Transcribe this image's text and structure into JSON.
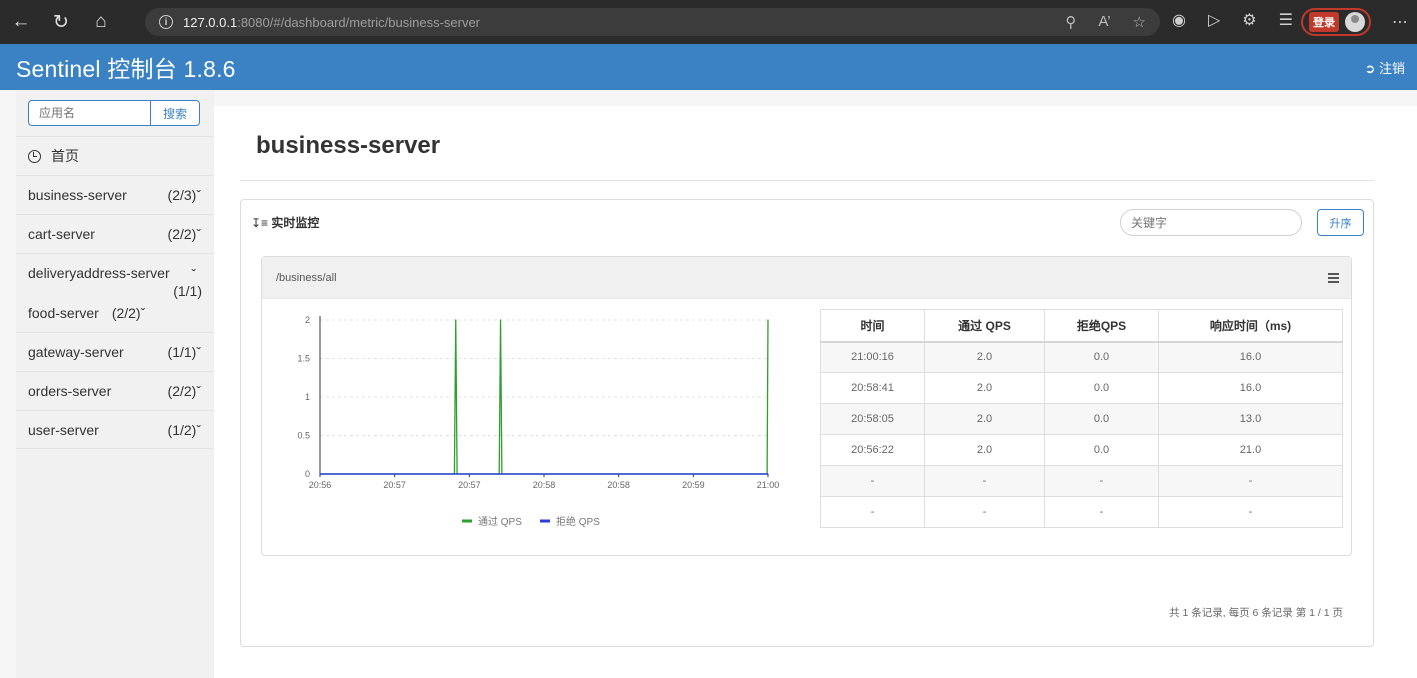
{
  "browser": {
    "url_host": "127.0.0.1",
    "url_rest": ":8080/#/dashboard/metric/business-server",
    "login_label": "登录"
  },
  "header": {
    "title": "Sentinel 控制台 1.8.6",
    "logout_label": "注销"
  },
  "sidebar": {
    "search_placeholder": "应用名",
    "search_button": "搜索",
    "home_label": "首页",
    "apps": [
      {
        "name": "business-server",
        "count": "(2/3)"
      },
      {
        "name": "cart-server",
        "count": "(2/2)"
      },
      {
        "name": "deliveryaddress-server",
        "count": "(1/1)"
      },
      {
        "name": "food-server",
        "count": "(2/2)"
      },
      {
        "name": "gateway-server",
        "count": "(1/1)"
      },
      {
        "name": "orders-server",
        "count": "(2/2)"
      },
      {
        "name": "user-server",
        "count": "(1/2)"
      }
    ]
  },
  "main": {
    "page_title": "business-server",
    "monitor_heading": "实时监控",
    "keyword_placeholder": "关键字",
    "sort_button": "升序",
    "resource_name": "/business/all",
    "pager_text": "共 1 条记录, 每页 6 条记录 第 1 / 1 页"
  },
  "table": {
    "headers": [
      "时间",
      "通过 QPS",
      "拒绝QPS",
      "响应时间（ms)"
    ],
    "rows": [
      [
        "21:00:16",
        "2.0",
        "0.0",
        "16.0"
      ],
      [
        "20:58:41",
        "2.0",
        "0.0",
        "16.0"
      ],
      [
        "20:58:05",
        "2.0",
        "0.0",
        "13.0"
      ],
      [
        "20:56:22",
        "2.0",
        "0.0",
        "21.0"
      ],
      [
        "-",
        "-",
        "-",
        "-"
      ],
      [
        "-",
        "-",
        "-",
        "-"
      ]
    ]
  },
  "chart_data": {
    "type": "line",
    "y_ticks": [
      "2",
      "1.5",
      "1",
      "0.5",
      "0"
    ],
    "x_ticks": [
      "20:56",
      "20:57",
      "20:57",
      "20:58",
      "20:58",
      "20:59",
      "21:00"
    ],
    "ylim": [
      0,
      2
    ],
    "series": [
      {
        "name": "通过 QPS",
        "color": "#2e9e2e",
        "x": [
          0,
          0.3,
          0.303,
          0.306,
          0.4,
          0.403,
          0.406,
          0.998,
          1.0
        ],
        "values": [
          0,
          0,
          2,
          0,
          0,
          2,
          0,
          0,
          2
        ]
      },
      {
        "name": "拒绝 QPS",
        "color": "#2b3fd6",
        "x": [
          0,
          1.0
        ],
        "values": [
          0,
          0
        ]
      }
    ],
    "legend": [
      "通过 QPS",
      "拒绝 QPS"
    ],
    "legend_position": "bottom"
  }
}
